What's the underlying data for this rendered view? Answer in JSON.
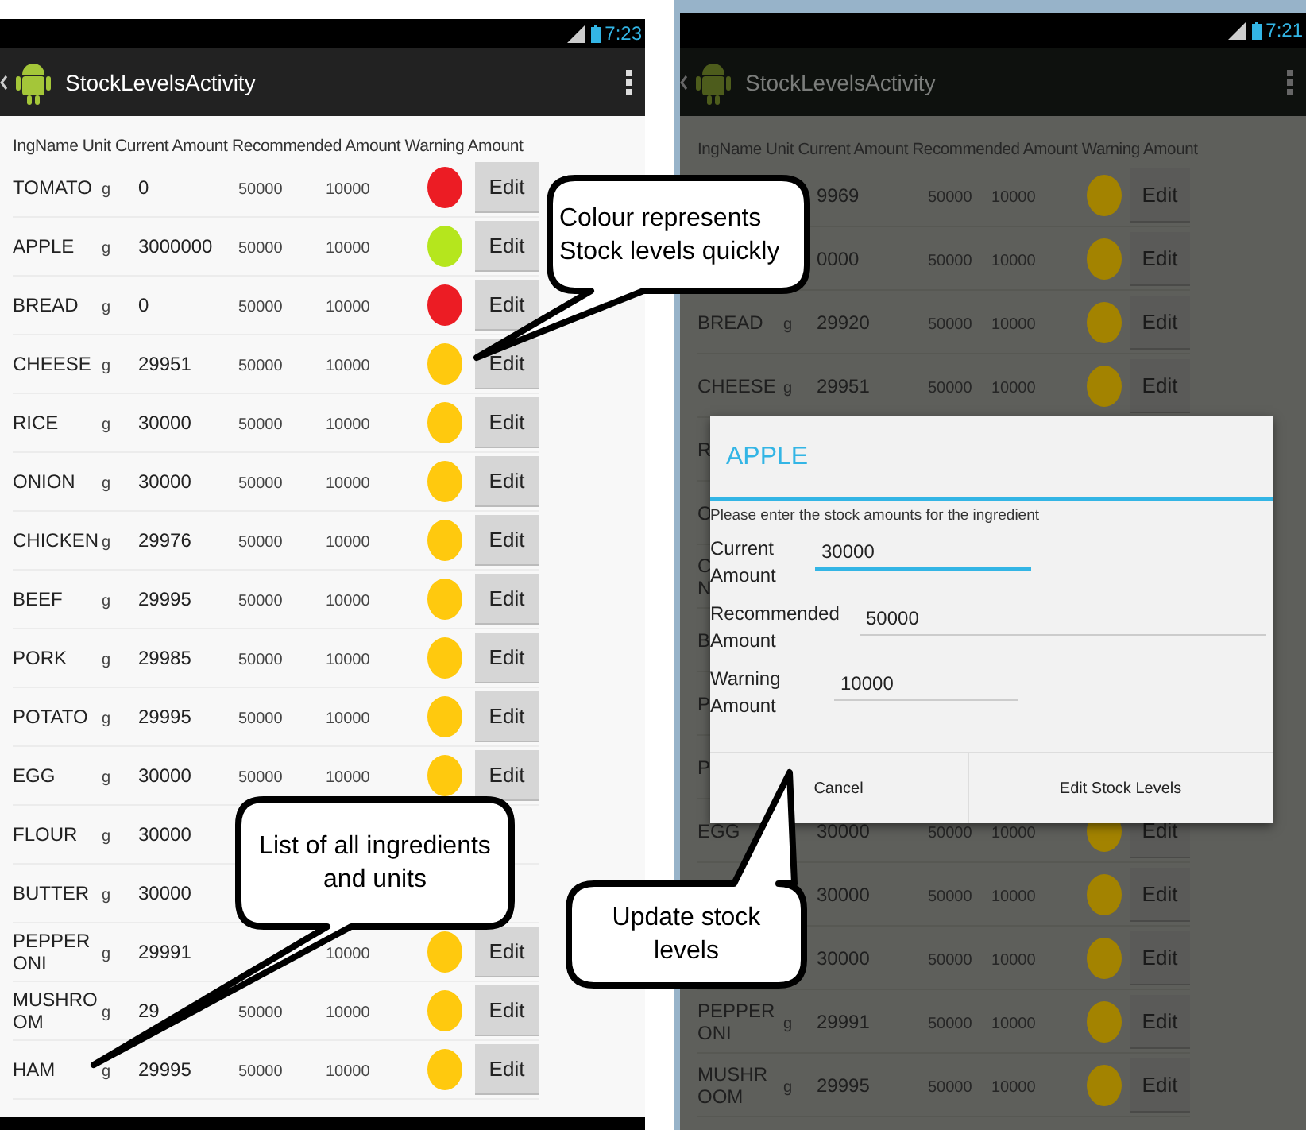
{
  "screens": [
    {
      "dimmed": false,
      "time": "7:23",
      "title": "StockLevelsActivity",
      "header": "IngName Unit Current Amount Recommended Amount Warning Amount",
      "rows": [
        {
          "kind": "full",
          "name": "TOMATO",
          "unit": "g",
          "current": "0",
          "recommended": "50000",
          "warning": "10000",
          "color": "#ec1c24",
          "edit": "Edit"
        },
        {
          "kind": "full",
          "name": "APPLE",
          "unit": "g",
          "current": "3000000",
          "recommended": "50000",
          "warning": "10000",
          "color": "#b5e61d",
          "edit": "Edit"
        },
        {
          "kind": "full",
          "name": "BREAD",
          "unit": "g",
          "current": "0",
          "recommended": "50000",
          "warning": "10000",
          "color": "#ec1c24",
          "edit": "Edit"
        },
        {
          "kind": "full",
          "name": "CHEESE",
          "unit": "g",
          "current": "29951",
          "recommended": "50000",
          "warning": "10000",
          "color": "#ffc90e",
          "edit": "Edit"
        },
        {
          "kind": "full",
          "name": "RICE",
          "unit": "g",
          "current": "30000",
          "recommended": "50000",
          "warning": "10000",
          "color": "#ffc90e",
          "edit": "Edit"
        },
        {
          "kind": "full",
          "name": "ONION",
          "unit": "g",
          "current": "30000",
          "recommended": "50000",
          "warning": "10000",
          "color": "#ffc90e",
          "edit": "Edit"
        },
        {
          "kind": "full",
          "name": "CHICKEN",
          "unit": "g",
          "current": "29976",
          "recommended": "50000",
          "warning": "10000",
          "color": "#ffc90e",
          "edit": "Edit"
        },
        {
          "kind": "full",
          "name": "BEEF",
          "unit": "g",
          "current": "29995",
          "recommended": "50000",
          "warning": "10000",
          "color": "#ffc90e",
          "edit": "Edit"
        },
        {
          "kind": "full",
          "name": "PORK",
          "unit": "g",
          "current": "29985",
          "recommended": "50000",
          "warning": "10000",
          "color": "#ffc90e",
          "edit": "Edit"
        },
        {
          "kind": "full",
          "name": "POTATO",
          "unit": "g",
          "current": "29995",
          "recommended": "50000",
          "warning": "10000",
          "color": "#ffc90e",
          "edit": "Edit"
        },
        {
          "kind": "full",
          "name": "EGG",
          "unit": "g",
          "current": "30000",
          "recommended": "50000",
          "warning": "10000",
          "color": "#ffc90e",
          "edit": "Edit"
        },
        {
          "kind": "full",
          "name": "FLOUR",
          "unit": "g",
          "current": "30000"
        },
        {
          "kind": "full",
          "name": "BUTTER",
          "unit": "g",
          "current": "30000"
        },
        {
          "kind": "full",
          "name": "PEPPERONI",
          "unit": "g",
          "current": "29991",
          "warning": "10000",
          "color": "#ffc90e",
          "edit": "Edit"
        },
        {
          "kind": "full",
          "name": "MUSHROOM",
          "unit": "g",
          "current": "29",
          "recommended": "50000",
          "warning": "10000",
          "color": "#ffc90e",
          "edit": "Edit"
        },
        {
          "kind": "full",
          "name": "HAM",
          "unit": "g",
          "current": "29995",
          "recommended": "50000",
          "warning": "10000",
          "color": "#ffc90e",
          "edit": "Edit"
        }
      ]
    },
    {
      "dimmed": true,
      "time": "7:21",
      "title": "StockLevelsActivity",
      "header": "IngName Unit Current Amount Recommended Amount Warning Amount",
      "rows": [
        {
          "kind": "full",
          "current": "9969",
          "recommended": "50000",
          "warning": "10000",
          "color": "#a38300",
          "edit": "Edit"
        },
        {
          "kind": "full",
          "current": "0000",
          "recommended": "50000",
          "warning": "10000",
          "color": "#a38300",
          "edit": "Edit"
        },
        {
          "kind": "full",
          "name": "BREAD",
          "unit": "g",
          "current": "29920",
          "recommended": "50000",
          "warning": "10000",
          "color": "#a38300",
          "edit": "Edit"
        },
        {
          "kind": "full",
          "name": "CHEESE",
          "unit": "g",
          "current": "29951",
          "recommended": "50000",
          "warning": "10000",
          "color": "#a38300",
          "edit": "Edit"
        },
        {
          "kind": "clipped",
          "name": "R"
        },
        {
          "kind": "clipped",
          "name": "O"
        },
        {
          "kind": "clipped",
          "name": "C N"
        },
        {
          "kind": "clipped",
          "name": "B"
        },
        {
          "kind": "clipped",
          "name": "P"
        },
        {
          "kind": "clipped",
          "name": "P"
        },
        {
          "kind": "full",
          "name": "EGG",
          "current": "30000",
          "recommended": "50000",
          "warning": "10000",
          "color": "#a38300",
          "edit": "Edit"
        },
        {
          "kind": "full",
          "current": "30000",
          "recommended": "50000",
          "warning": "10000",
          "color": "#a38300",
          "edit": "Edit"
        },
        {
          "kind": "full",
          "current": "30000",
          "recommended": "50000",
          "warning": "10000",
          "color": "#a38300",
          "edit": "Edit"
        },
        {
          "kind": "full",
          "name": "PEPPERONI",
          "unit": "g",
          "current": "29991",
          "recommended": "50000",
          "warning": "10000",
          "color": "#a38300",
          "edit": "Edit"
        },
        {
          "kind": "full",
          "name": "MUSHROOM",
          "unit": "g",
          "current": "29995",
          "recommended": "50000",
          "warning": "10000",
          "color": "#a38300",
          "edit": "Edit"
        }
      ],
      "dialog": {
        "title": "APPLE",
        "message": "Please enter the stock amounts for the ingredient",
        "fields": [
          {
            "label": "Current Amount",
            "value": "30000",
            "focused": true
          },
          {
            "label": "Recommended Amount",
            "value": "50000",
            "focused": false
          },
          {
            "label": "Warning Amount",
            "value": "10000",
            "focused": false
          }
        ],
        "buttons": [
          "Cancel",
          "Edit Stock Levels"
        ]
      }
    }
  ],
  "callouts": [
    {
      "text": "Colour represents Stock levels quickly"
    },
    {
      "text": "List of all ingredients and units"
    },
    {
      "text": "Update stock levels"
    }
  ]
}
